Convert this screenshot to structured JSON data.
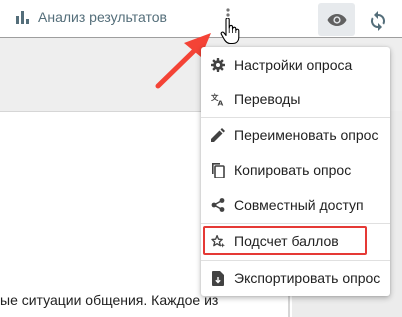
{
  "toolbar": {
    "analysis_label": "Анализ результатов",
    "analysis_icon": "bar-chart-icon",
    "more_icon": "more-vertical-icon",
    "preview_icon": "eye-icon",
    "refresh_icon": "sync-icon"
  },
  "menu": {
    "items": [
      {
        "label": "Настройки опроса",
        "icon": "gear-icon"
      },
      {
        "label": "Переводы",
        "icon": "translate-icon"
      },
      {
        "label": "Переименовать опрос",
        "icon": "pencil-icon"
      },
      {
        "label": "Копировать опрос",
        "icon": "copy-icon"
      },
      {
        "label": "Совместный доступ",
        "icon": "share-icon"
      },
      {
        "label": "Подсчет баллов",
        "icon": "star-sparkle-icon"
      },
      {
        "label": "Экспортировать опрос",
        "icon": "export-file-icon"
      }
    ]
  },
  "content": {
    "body_text": "ые ситуации общения. Каждое из"
  },
  "colors": {
    "accent_gray": "#546e7a",
    "highlight_red": "#e53935",
    "arrow_red": "#f44336"
  }
}
